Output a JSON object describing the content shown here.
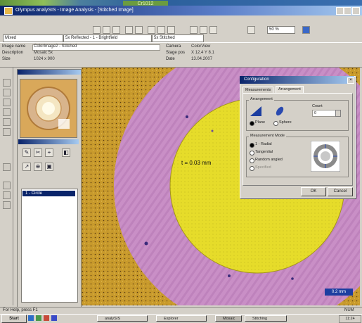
{
  "desktop": {
    "tag": "Cr1012"
  },
  "window": {
    "title": "Olympus analySIS - Image Analysis - [Stitched Image]"
  },
  "toolbar": {
    "combo_1": "Mixed",
    "combo_2": "5x Reflected - 1 - Brightfield",
    "combo_3": "5x Stitched",
    "zoom": "50 %"
  },
  "info": {
    "labels": [
      "Image name",
      "Description",
      "Size"
    ],
    "values": [
      "ColorImage2 - Stitched",
      "Mosaic 5x",
      "1024 x 900"
    ],
    "labels_2": [
      "Camera",
      "Stage pos",
      "Date"
    ],
    "values_2": [
      "ColorView",
      "X 12.4 Y 8.1",
      "13.04.2007"
    ]
  },
  "panel": {
    "tools": [
      "✎",
      "✂",
      "⌖",
      "◧",
      "↗",
      "⊕",
      "▣"
    ],
    "tree_item": "1 - Circle"
  },
  "image": {
    "measurement": "t = 0.03 mm",
    "scale_bar": "0.2 mm",
    "colors": {
      "background": "#c89a2c",
      "ring": "#c98fc6",
      "core": "#e6dc2a",
      "dialog_bg": "#d4d0c8"
    }
  },
  "dialog": {
    "title": "Configuration",
    "tabs": [
      "Measurements",
      "Arrangement"
    ],
    "group_1": "Arrangement",
    "option_a": "Plane",
    "option_b": "Sphere",
    "spin_label": "Count",
    "spin_value": "0",
    "group_2": "Measurement Mode",
    "modes": [
      "1 - Radial",
      "Tangential",
      "Random angled",
      "Specified"
    ],
    "ok": "OK",
    "cancel": "Cancel"
  },
  "status": {
    "text": "For Help, press F1",
    "right": "NUM"
  },
  "taskbar": {
    "start": "Start",
    "tasks": [
      "analySIS",
      "Explorer",
      "Mosaic",
      "Stitching"
    ],
    "clock": "11:24"
  }
}
